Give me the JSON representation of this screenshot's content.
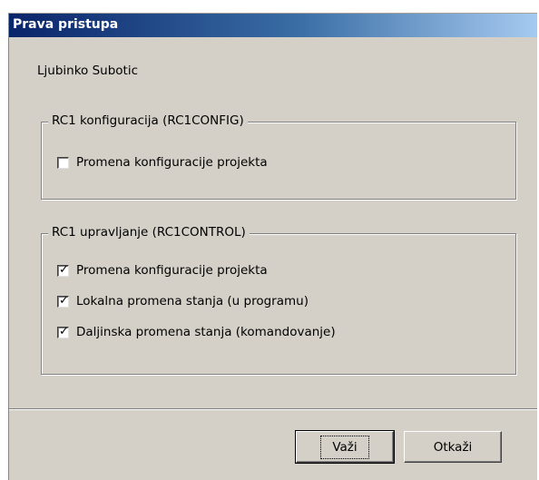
{
  "dialog": {
    "title": "Prava pristupa",
    "user_name": "Ljubinko Subotic"
  },
  "groups": [
    {
      "legend": "RC1 konfiguracija (RC1CONFIG)",
      "items": [
        {
          "label": "Promena konfiguracije projekta",
          "checked": false
        }
      ]
    },
    {
      "legend": "RC1 upravljanje (RC1CONTROL)",
      "items": [
        {
          "label": "Promena konfiguracije projekta",
          "checked": true
        },
        {
          "label": "Lokalna promena stanja (u programu)",
          "checked": true
        },
        {
          "label": "Daljinska promena stanja (komandovanje)",
          "checked": true
        }
      ]
    }
  ],
  "buttons": {
    "ok_label": "Važi",
    "cancel_label": "Otkaži"
  }
}
